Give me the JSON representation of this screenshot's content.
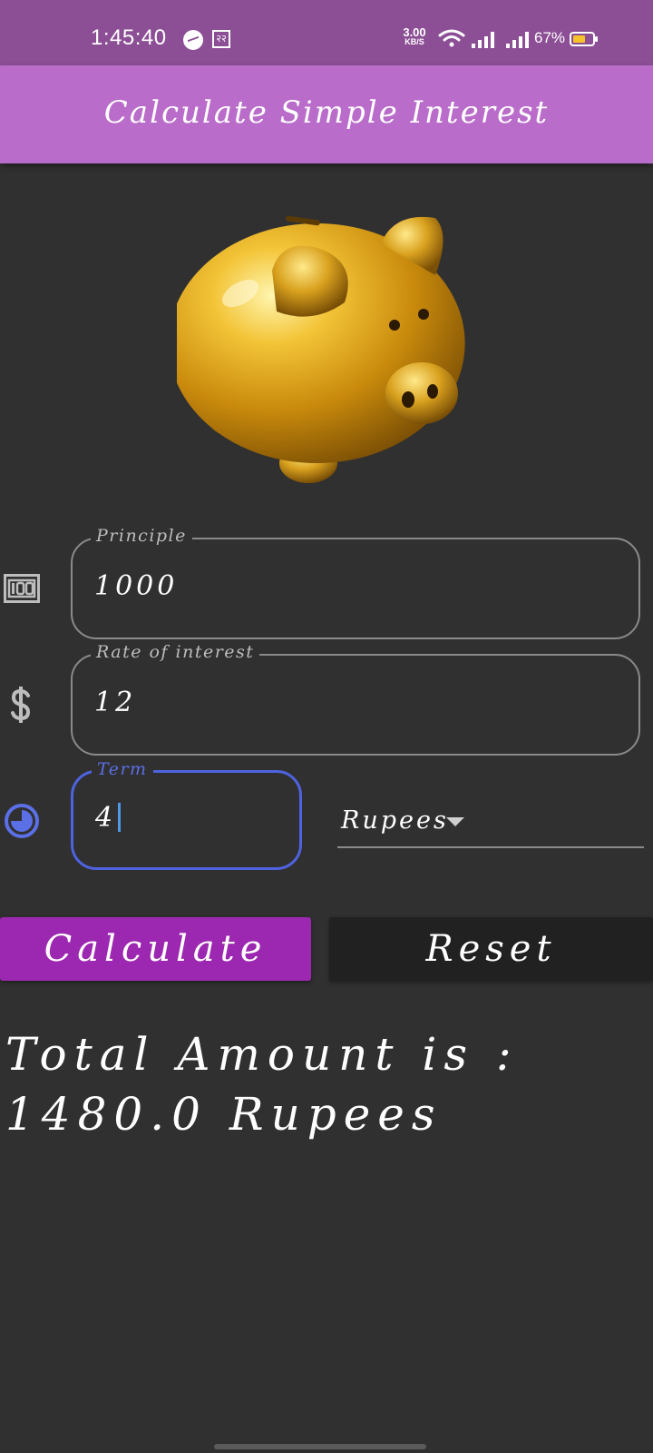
{
  "status_bar": {
    "time": "1:45:40",
    "sim_badge": "२२",
    "net_speed": "3.00",
    "net_speed_unit": "KB/S",
    "battery_percent": "67%",
    "battery_level": 0.67
  },
  "app_bar": {
    "title": "Calculate Simple Interest",
    "color": "#b96cc9"
  },
  "form": {
    "principle": {
      "label": "Principle",
      "value": "1000",
      "icon": "money-100-icon"
    },
    "rate": {
      "label": "Rate of interest",
      "value": "12",
      "icon": "dollar-icon"
    },
    "term": {
      "label": "Term",
      "value": "4",
      "icon": "clock-icon"
    },
    "currency": {
      "selected": "Rupees"
    }
  },
  "buttons": {
    "calculate": "Calculate",
    "reset": "Reset",
    "accent": "#9c27b0"
  },
  "result": {
    "text": "Total Amount is : 1480.0 Rupees"
  }
}
